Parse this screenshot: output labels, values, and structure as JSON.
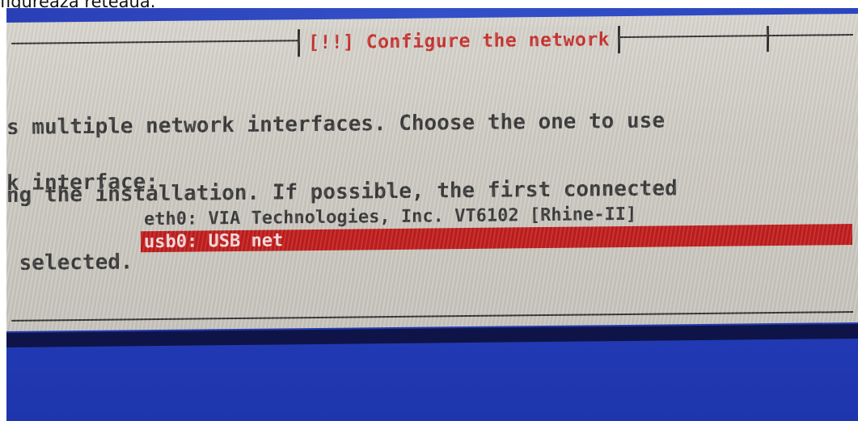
{
  "caption": "figurează rețeaua.",
  "dialog": {
    "title": "[!!] Configure the network",
    "description_lines": [
      "s multiple network interfaces. Choose the one to use",
      "ng the installation. If possible, the first connected",
      " selected."
    ],
    "prompt": "k interface:",
    "interfaces": [
      "eth0: VIA Technologies, Inc. VT6102 [Rhine-II]",
      "usb0: USB net"
    ],
    "selected_index": 1
  },
  "colors": {
    "screen_blue": "#243db8",
    "dialog_bg": "#d4d1c9",
    "title_red": "#c8322e",
    "selection_red": "#c11d1d"
  }
}
